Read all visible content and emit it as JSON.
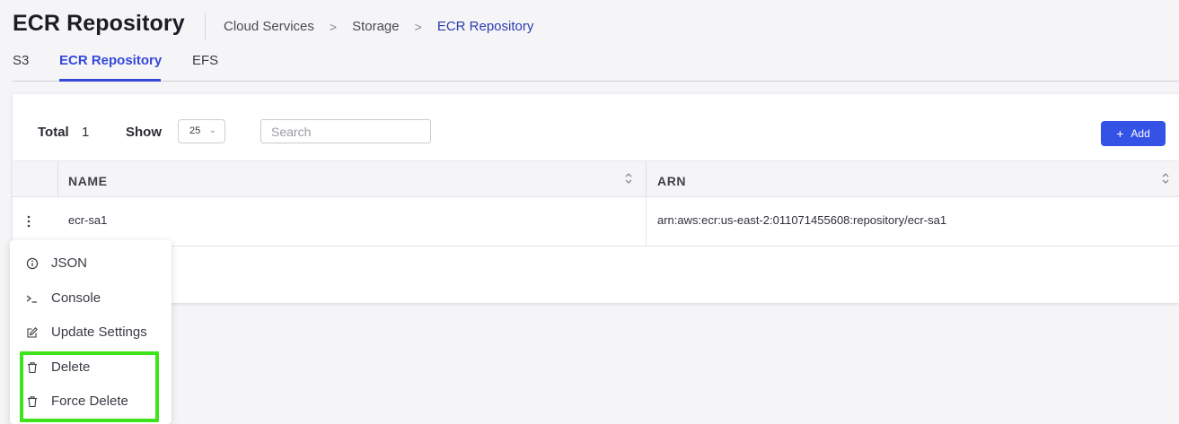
{
  "header": {
    "title": "ECR Repository",
    "breadcrumb": [
      "Cloud Services",
      "Storage",
      "ECR Repository"
    ],
    "breadcrumb_sep": ">"
  },
  "tabs": [
    {
      "label": "S3",
      "active": false
    },
    {
      "label": "ECR Repository",
      "active": true
    },
    {
      "label": "EFS",
      "active": false
    }
  ],
  "toolbar": {
    "total_label": "Total",
    "total_value": "1",
    "show_label": "Show",
    "show_value": "25",
    "search_placeholder": "Search",
    "search_value": "",
    "add_label": "Add"
  },
  "table": {
    "columns": [
      "NAME",
      "ARN"
    ],
    "rows": [
      {
        "name": "ecr-sa1",
        "arn": "arn:aws:ecr:us-east-2:011071455608:repository/ecr-sa1"
      }
    ]
  },
  "context_menu": {
    "items": [
      {
        "label": "JSON",
        "icon": "info-icon"
      },
      {
        "label": "Console",
        "icon": "terminal-icon"
      },
      {
        "label": "Update Settings",
        "icon": "edit-icon"
      },
      {
        "label": "Delete",
        "icon": "trash-icon"
      },
      {
        "label": "Force Delete",
        "icon": "trash-icon"
      }
    ],
    "highlight_color": "#3ee31c"
  },
  "colors": {
    "accent": "#3548d8",
    "add_button": "#3552e6",
    "page_bg": "#f5f5f7"
  }
}
